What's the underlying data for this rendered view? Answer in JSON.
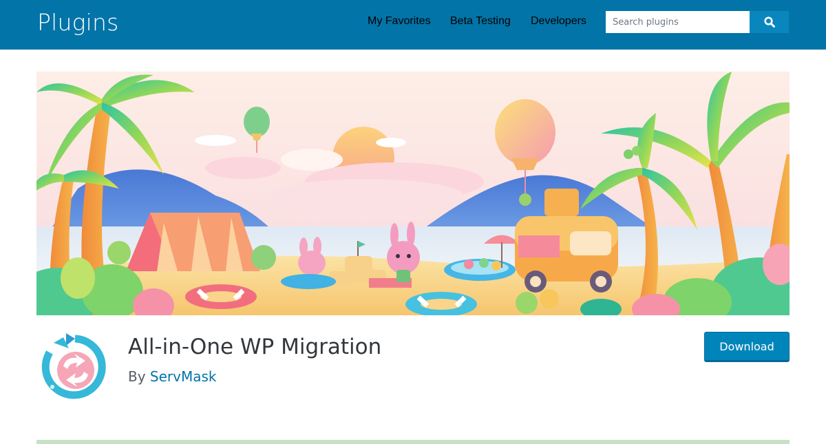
{
  "header": {
    "brand": "Plugins",
    "nav": [
      {
        "label": "My Favorites"
      },
      {
        "label": "Beta Testing"
      },
      {
        "label": "Developers"
      }
    ],
    "search": {
      "placeholder": "Search plugins",
      "value": ""
    },
    "colors": {
      "bar": "#0274a8",
      "search_button": "#0a86be"
    }
  },
  "plugin": {
    "title": "All-in-One WP Migration",
    "by_prefix": "By ",
    "author": "ServMask",
    "download_label": "Download",
    "icon": "migration-arrows-icon"
  }
}
